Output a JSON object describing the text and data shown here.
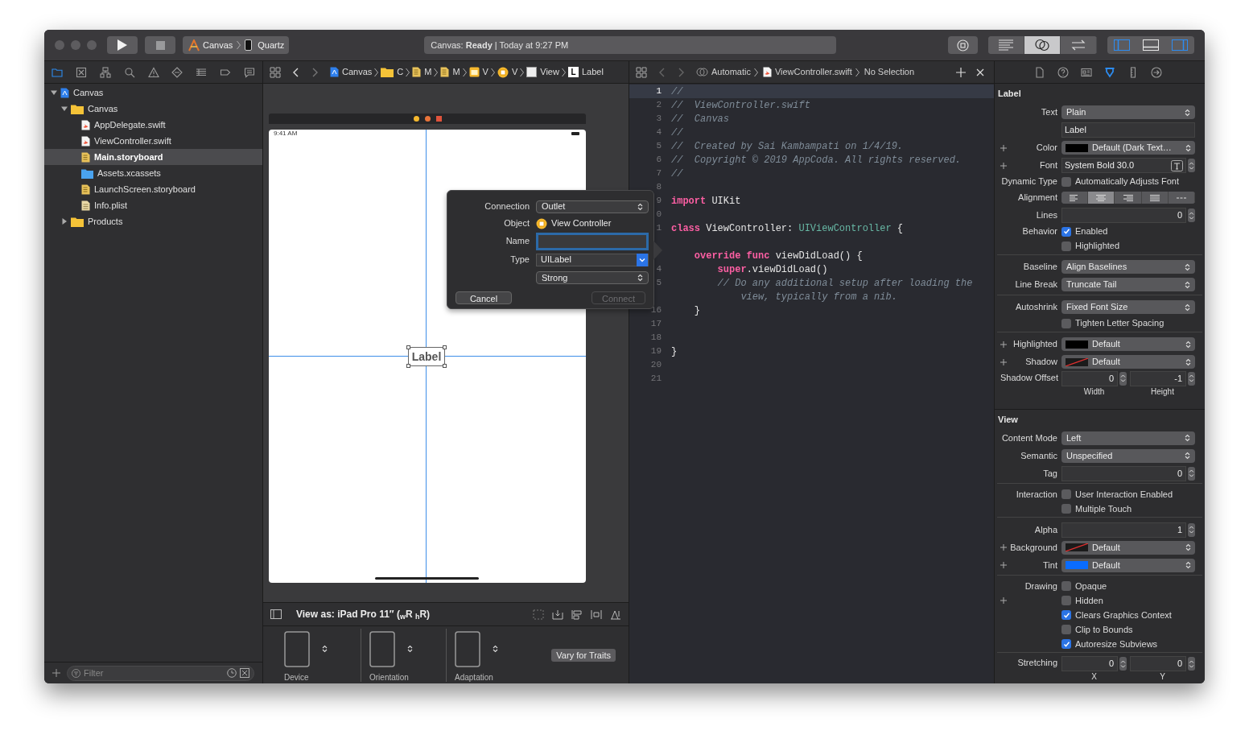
{
  "toolbar": {
    "scheme": {
      "project": "Canvas",
      "device": "Quartz"
    },
    "status": "Canvas: **Ready** | Today at 9:27 PM",
    "editor_modes": [
      {
        "kind": "standard",
        "selected": false
      },
      {
        "kind": "assistant",
        "selected": true
      },
      {
        "kind": "version",
        "selected": false
      }
    ],
    "panels": [
      {
        "kind": "navigator",
        "on": true
      },
      {
        "kind": "debug",
        "on": false
      },
      {
        "kind": "inspector",
        "on": true
      }
    ]
  },
  "navigator": {
    "tabs": [
      {
        "kind": "folder",
        "selected": true
      },
      {
        "kind": "source-control",
        "selected": false
      },
      {
        "kind": "hierarchy",
        "selected": false
      },
      {
        "kind": "search",
        "selected": false
      },
      {
        "kind": "warning",
        "selected": false
      },
      {
        "kind": "test",
        "selected": false
      },
      {
        "kind": "debug",
        "selected": false
      },
      {
        "kind": "breakpoint",
        "selected": false
      },
      {
        "kind": "report",
        "selected": false
      }
    ],
    "tree": [
      {
        "name": "Canvas",
        "kind": "project",
        "expanded": true,
        "selected": false,
        "children": [
          {
            "name": "Canvas",
            "kind": "folder",
            "expanded": true,
            "selected": false,
            "children": [
              {
                "name": "AppDelegate.swift",
                "kind": "swift",
                "selected": false
              },
              {
                "name": "ViewController.swift",
                "kind": "swift",
                "selected": false
              },
              {
                "name": "Main.storyboard",
                "kind": "storyboard",
                "selected": true
              },
              {
                "name": "Assets.xcassets",
                "kind": "assets",
                "selected": false
              },
              {
                "name": "LaunchScreen.storyboard",
                "kind": "storyboard",
                "selected": false
              },
              {
                "name": "Info.plist",
                "kind": "plist",
                "selected": false
              }
            ]
          },
          {
            "name": "Products",
            "kind": "folder",
            "expanded": false,
            "selected": false
          }
        ]
      }
    ],
    "filter": {
      "placeholder": "Filter"
    }
  },
  "jump_bar": [
    {
      "kind": "project",
      "text": "Canvas"
    },
    {
      "kind": "folder",
      "text": "C"
    },
    {
      "kind": "storyboard",
      "text": "M"
    },
    {
      "kind": "storyboard",
      "text": "M"
    },
    {
      "kind": "scene",
      "text": "V"
    },
    {
      "kind": "controller",
      "text": "V"
    },
    {
      "kind": "view",
      "text": "View"
    },
    {
      "kind": "label",
      "badge": "L",
      "text": "Label"
    }
  ],
  "canvas": {
    "status_time": "9:41 AM",
    "label_text": "Label",
    "view_as": "View as: iPad Pro 11″ ($_{w}$R $_{h}$R)",
    "configs": [
      {
        "label": "Device"
      },
      {
        "label": "Orientation"
      },
      {
        "label": "Adaptation"
      }
    ],
    "vary_button": "Vary for Traits"
  },
  "popup": {
    "connection_label": "Connection",
    "connection": "Outlet",
    "object_label": "Object",
    "object": "View Controller",
    "name_label": "Name",
    "name_focused": true,
    "type_label": "Type",
    "type": "UILabel",
    "storage": "Strong",
    "cancel": "Cancel",
    "connect": "Connect",
    "connect_disabled": true
  },
  "editor": {
    "jump": [
      {
        "kind": "automatic",
        "text": "Automatic"
      },
      {
        "kind": "swift",
        "text": "ViewController.swift"
      },
      {
        "text": "No Selection"
      }
    ],
    "lines": [
      {
        "number": "1",
        "current": true,
        "tokens": [
          {
            "kind": "comment",
            "text": "//"
          }
        ]
      },
      {
        "number": "2",
        "current": false,
        "tokens": [
          {
            "kind": "comment",
            "text": "//  ViewController.swift"
          }
        ]
      },
      {
        "number": "3",
        "current": false,
        "tokens": [
          {
            "kind": "comment",
            "text": "//  Canvas"
          }
        ]
      },
      {
        "number": "4",
        "current": false,
        "tokens": [
          {
            "kind": "comment",
            "text": "//"
          }
        ]
      },
      {
        "number": "5",
        "current": false,
        "tokens": [
          {
            "kind": "comment",
            "text": "//  Created by Sai Kambampati on 1/4/19."
          }
        ]
      },
      {
        "number": "6",
        "current": false,
        "tokens": [
          {
            "kind": "comment",
            "text": "//  Copyright © 2019 AppCoda. All rights reserved."
          }
        ]
      },
      {
        "number": "7",
        "current": false,
        "tokens": [
          {
            "kind": "comment",
            "text": "//"
          }
        ]
      },
      {
        "number": "8",
        "current": false
      },
      {
        "number": "9",
        "current": false,
        "tokens": [
          {
            "kind": "keyword",
            "text": "import"
          },
          {
            "kind": "plain",
            "text": " UIKit"
          }
        ]
      },
      {
        "number": "0",
        "current": false
      },
      {
        "number": "1",
        "current": false,
        "tokens": [
          {
            "kind": "keyword",
            "text": "class"
          },
          {
            "kind": "plain",
            "text": " ViewController: "
          },
          {
            "kind": "type",
            "text": "UIViewController"
          },
          {
            "kind": "plain",
            "text": " {"
          }
        ]
      },
      {
        "current": false
      },
      {
        "current": false,
        "tokens": [
          {
            "kind": "keyword",
            "text": "    override"
          },
          {
            "kind": "keyword",
            "text": " func"
          },
          {
            "kind": "plain",
            "text": " viewDidLoad() {"
          }
        ]
      },
      {
        "number": "4",
        "current": false,
        "tokens": [
          {
            "kind": "keyword",
            "text": "        super"
          },
          {
            "kind": "plain",
            "text": ".viewDidLoad()"
          }
        ]
      },
      {
        "number": "5",
        "current": false,
        "tokens": [
          {
            "kind": "comment",
            "text": "        // Do any additional setup after loading the"
          }
        ]
      },
      {
        "current": false,
        "tokens": [
          {
            "kind": "comment",
            "text": "            view, typically from a nib."
          }
        ]
      },
      {
        "number": "16",
        "current": false,
        "tokens": [
          {
            "kind": "plain",
            "text": "    }"
          }
        ]
      },
      {
        "number": "17",
        "current": false
      },
      {
        "number": "18",
        "current": false
      },
      {
        "number": "19",
        "current": false,
        "tokens": [
          {
            "kind": "plain",
            "text": "}"
          }
        ]
      },
      {
        "number": "20",
        "current": false
      },
      {
        "number": "21",
        "current": false
      }
    ]
  },
  "inspector": {
    "tabs": [
      {
        "kind": "file",
        "selected": false
      },
      {
        "kind": "help",
        "selected": false
      },
      {
        "kind": "identity",
        "selected": false
      },
      {
        "kind": "attributes",
        "selected": true
      },
      {
        "kind": "size",
        "selected": false
      },
      {
        "kind": "connections",
        "selected": false
      }
    ],
    "sections": [
      {
        "title": "Label",
        "groups": [
          [
            {
              "kind": "select",
              "label": "Text",
              "value": "Plain"
            },
            {
              "kind": "text",
              "value": "Label"
            },
            {
              "kind": "color",
              "plus": true,
              "label": "Color",
              "value": "Default (Dark Text…",
              "color": "#000000"
            },
            {
              "kind": "font",
              "plus": true,
              "label": "Font",
              "value": "System Bold 30.0"
            },
            {
              "kind": "check",
              "label": "Dynamic Type",
              "text": "Automatically Adjusts Font",
              "checked": false
            },
            {
              "kind": "align",
              "label": "Alignment",
              "options": [
                {
                  "kind": "left",
                  "selected": false
                },
                {
                  "kind": "center",
                  "selected": true
                },
                {
                  "kind": "right",
                  "selected": false
                },
                {
                  "kind": "justified",
                  "selected": false
                },
                {
                  "kind": "natural",
                  "selected": false
                }
              ]
            },
            {
              "kind": "stepper",
              "label": "Lines",
              "value": "0"
            },
            {
              "kind": "check",
              "label": "Behavior",
              "text": "Enabled",
              "checked": true
            },
            {
              "kind": "check",
              "text": "Highlighted",
              "checked": false
            }
          ],
          [
            {
              "kind": "select",
              "label": "Baseline",
              "value": "Align Baselines"
            },
            {
              "kind": "select",
              "label": "Line Break",
              "value": "Truncate Tail"
            }
          ],
          [
            {
              "kind": "select",
              "label": "Autoshrink",
              "value": "Fixed Font Size"
            },
            {
              "kind": "check",
              "text": "Tighten Letter Spacing",
              "checked": false
            }
          ],
          [
            {
              "kind": "color",
              "plus": true,
              "label": "Highlighted",
              "value": "Default",
              "color": "#000000"
            },
            {
              "kind": "color",
              "plus": true,
              "label": "Shadow",
              "value": "Default"
            },
            {
              "kind": "pair",
              "label": "Shadow Offset",
              "values": [
                "0",
                "-1"
              ],
              "sublabels": [
                "Width",
                "Height"
              ]
            }
          ]
        ]
      },
      {
        "title": "View",
        "groups": [
          [
            {
              "kind": "select",
              "label": "Content Mode",
              "value": "Left"
            },
            {
              "kind": "select",
              "label": "Semantic",
              "value": "Unspecified"
            },
            {
              "kind": "stepper",
              "label": "Tag",
              "value": "0"
            }
          ],
          [
            {
              "kind": "check",
              "label": "Interaction",
              "text": "User Interaction Enabled",
              "checked": false
            },
            {
              "kind": "check",
              "text": "Multiple Touch",
              "checked": false
            }
          ],
          [
            {
              "kind": "stepper",
              "label": "Alpha",
              "value": "1"
            },
            {
              "kind": "color",
              "plus": true,
              "label": "Background",
              "value": "Default"
            },
            {
              "kind": "color",
              "plus": true,
              "label": "Tint",
              "value": "Default",
              "color": "#0a6cff"
            }
          ],
          [
            {
              "kind": "check",
              "label": "Drawing",
              "text": "Opaque",
              "checked": false
            },
            {
              "kind": "check",
              "plus": true,
              "text": "Hidden",
              "checked": false
            },
            {
              "kind": "check",
              "text": "Clears Graphics Context",
              "checked": true
            },
            {
              "kind": "check",
              "text": "Clip to Bounds",
              "checked": false
            },
            {
              "kind": "check",
              "text": "Autoresize Subviews",
              "checked": true
            }
          ],
          [
            {
              "kind": "pair",
              "label": "Stretching",
              "values": [
                "0",
                "0"
              ],
              "sublabels": [
                "X",
                "Y"
              ]
            }
          ]
        ]
      }
    ]
  }
}
